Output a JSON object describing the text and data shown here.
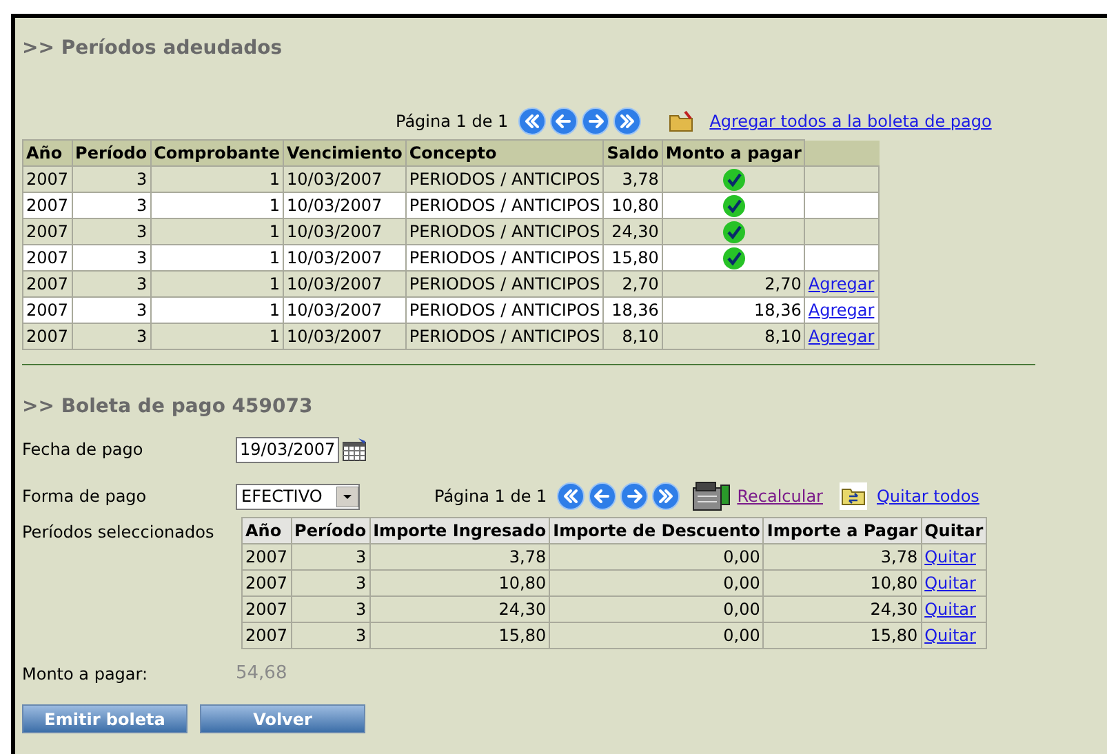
{
  "debts": {
    "title": ">> Períodos adeudados",
    "pager": {
      "label": "Página 1 de 1"
    },
    "add_all_link": "Agregar todos a la boleta de pago",
    "columns": [
      "Año",
      "Período",
      "Comprobante",
      "Vencimiento",
      "Concepto",
      "Saldo",
      "Monto a pagar"
    ],
    "rows": [
      {
        "year": "2007",
        "period": "3",
        "voucher": "1",
        "due": "10/03/2007",
        "concept": "PERIODOS / ANTICIPOS",
        "balance": "3,78",
        "added": true
      },
      {
        "year": "2007",
        "period": "3",
        "voucher": "1",
        "due": "10/03/2007",
        "concept": "PERIODOS / ANTICIPOS",
        "balance": "10,80",
        "added": true
      },
      {
        "year": "2007",
        "period": "3",
        "voucher": "1",
        "due": "10/03/2007",
        "concept": "PERIODOS / ANTICIPOS",
        "balance": "24,30",
        "added": true
      },
      {
        "year": "2007",
        "period": "3",
        "voucher": "1",
        "due": "10/03/2007",
        "concept": "PERIODOS / ANTICIPOS",
        "balance": "15,80",
        "added": true
      },
      {
        "year": "2007",
        "period": "3",
        "voucher": "1",
        "due": "10/03/2007",
        "concept": "PERIODOS / ANTICIPOS",
        "balance": "2,70",
        "added": false,
        "amount": "2,70",
        "action": "Agregar"
      },
      {
        "year": "2007",
        "period": "3",
        "voucher": "1",
        "due": "10/03/2007",
        "concept": "PERIODOS / ANTICIPOS",
        "balance": "18,36",
        "added": false,
        "amount": "18,36",
        "action": "Agregar"
      },
      {
        "year": "2007",
        "period": "3",
        "voucher": "1",
        "due": "10/03/2007",
        "concept": "PERIODOS / ANTICIPOS",
        "balance": "8,10",
        "added": false,
        "amount": "8,10",
        "action": "Agregar"
      }
    ]
  },
  "voucher": {
    "title": ">> Boleta de pago 459073",
    "date_label": "Fecha de pago",
    "date_value": "19/03/2007",
    "method_label": "Forma de pago",
    "method_value": "EFECTIVO",
    "pager": {
      "label": "Página 1 de 1"
    },
    "recalc_link": "Recalcular",
    "remove_all_link": "Quitar todos",
    "selected_label": "Períodos seleccionados",
    "columns": [
      "Año",
      "Período",
      "Importe Ingresado",
      "Importe de Descuento",
      "Importe a Pagar",
      "Quitar"
    ],
    "rows": [
      {
        "year": "2007",
        "period": "3",
        "entered": "3,78",
        "discount": "0,00",
        "to_pay": "3,78",
        "action": "Quitar"
      },
      {
        "year": "2007",
        "period": "3",
        "entered": "10,80",
        "discount": "0,00",
        "to_pay": "10,80",
        "action": "Quitar"
      },
      {
        "year": "2007",
        "period": "3",
        "entered": "24,30",
        "discount": "0,00",
        "to_pay": "24,30",
        "action": "Quitar"
      },
      {
        "year": "2007",
        "period": "3",
        "entered": "15,80",
        "discount": "0,00",
        "to_pay": "15,80",
        "action": "Quitar"
      }
    ],
    "total_label": "Monto a pagar:",
    "total_value": "54,68"
  },
  "buttons": [
    "Emitir boleta",
    "Volver"
  ]
}
